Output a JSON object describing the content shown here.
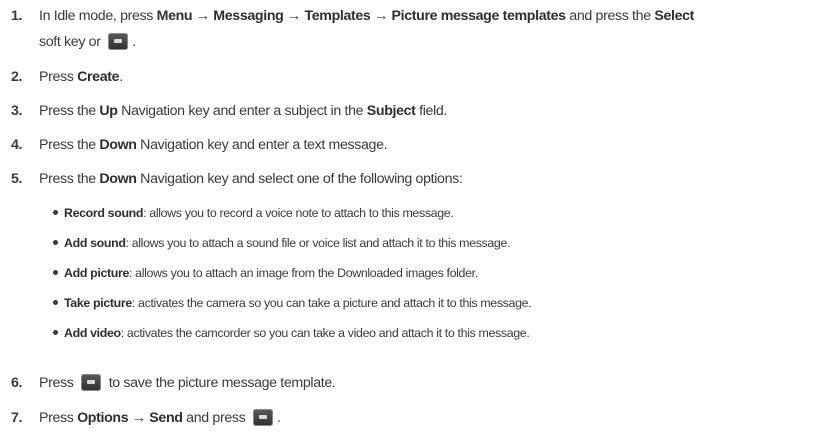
{
  "steps": [
    {
      "num": "1.",
      "parts": {
        "a": "In Idle mode, press ",
        "b1": "Menu",
        "arrow1": " → ",
        "b2": "Messaging",
        "arrow2": " → ",
        "b3": "Templates",
        "arrow3": " → ",
        "b4": "Picture message templates",
        "c": " and press the ",
        "b5": "Select",
        "line2a": "soft key or ",
        "line2b": "."
      }
    },
    {
      "num": "2.",
      "a": "Press ",
      "b1": "Create",
      "c": "."
    },
    {
      "num": "3.",
      "a": "Press the ",
      "b1": "Up",
      "c": " Navigation key and enter a subject in the ",
      "b2": "Subject",
      "d": " field."
    },
    {
      "num": "4.",
      "a": "Press the ",
      "b1": "Down",
      "c": " Navigation key and enter a text message."
    },
    {
      "num": "5.",
      "a": "Press the ",
      "b1": "Down",
      "c": " Navigation key and select one of the following options:"
    },
    {
      "num": "6.",
      "a": "Press ",
      "c": " to save the picture message template."
    },
    {
      "num": "7.",
      "a": "Press ",
      "b1": "Options",
      "arrow1": " → ",
      "b2": "Send",
      "c": " and press ",
      "d": "."
    }
  ],
  "options": [
    {
      "label": "Record sound",
      "desc": ": allows you to record a voice note to attach to this message."
    },
    {
      "label": "Add sound",
      "desc": ": allows you to attach a sound file or voice list and attach it to this message."
    },
    {
      "label": "Add picture",
      "desc": ": allows you to attach an image from the Downloaded images folder."
    },
    {
      "label": "Take picture",
      "desc": ": activates the camera so you can take a picture and attach it to this message."
    },
    {
      "label": "Add video",
      "desc": ": activates the camcorder so you can take a video and attach it to this message."
    }
  ],
  "icons": {
    "ok_key": "ok-key-icon"
  }
}
